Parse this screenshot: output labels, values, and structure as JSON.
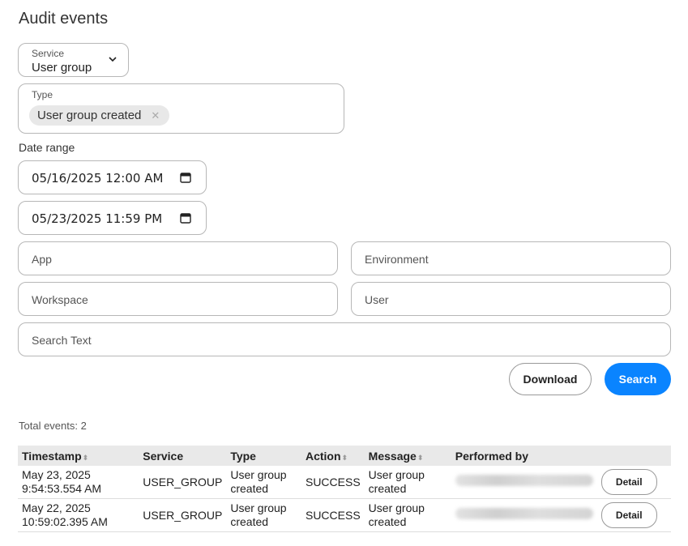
{
  "page": {
    "title": "Audit events"
  },
  "filters": {
    "service": {
      "label": "Service",
      "value": "User group"
    },
    "type": {
      "label": "Type",
      "chips": [
        "User group created"
      ]
    },
    "date_range": {
      "label": "Date range",
      "start": "05/16/2025 12:00 AM",
      "end": "05/23/2025 11:59 PM"
    },
    "app": {
      "placeholder": "App"
    },
    "environment": {
      "placeholder": "Environment"
    },
    "workspace": {
      "placeholder": "Workspace"
    },
    "user": {
      "placeholder": "User"
    },
    "search_text": {
      "placeholder": "Search Text"
    }
  },
  "actions": {
    "download_label": "Download",
    "search_label": "Search"
  },
  "results": {
    "total_label": "Total events: 2",
    "columns": [
      "Timestamp",
      "Service",
      "Type",
      "Action",
      "Message",
      "Performed by"
    ],
    "rows": [
      {
        "timestamp_date": "May 23, 2025",
        "timestamp_time": "9:54:53.554 AM",
        "service": "USER_GROUP",
        "type_line1": "User group",
        "type_line2": "created",
        "action": "SUCCESS",
        "message_line1": "User group",
        "message_line2": "created",
        "detail_label": "Detail"
      },
      {
        "timestamp_date": "May 22, 2025",
        "timestamp_time": "10:59:02.395 AM",
        "service": "USER_GROUP",
        "type_line1": "User group",
        "type_line2": "created",
        "action": "SUCCESS",
        "message_line1": "User group",
        "message_line2": "created",
        "detail_label": "Detail"
      }
    ]
  },
  "colors": {
    "accent": "#0a84ff",
    "border": "#b7b7b7",
    "header_bg": "#e9e9e9"
  },
  "icons": {
    "service_dropdown": "chevron-down-icon",
    "date_picker": "calendar-icon",
    "chip_remove": "close-icon",
    "sort": "sort-icon"
  }
}
